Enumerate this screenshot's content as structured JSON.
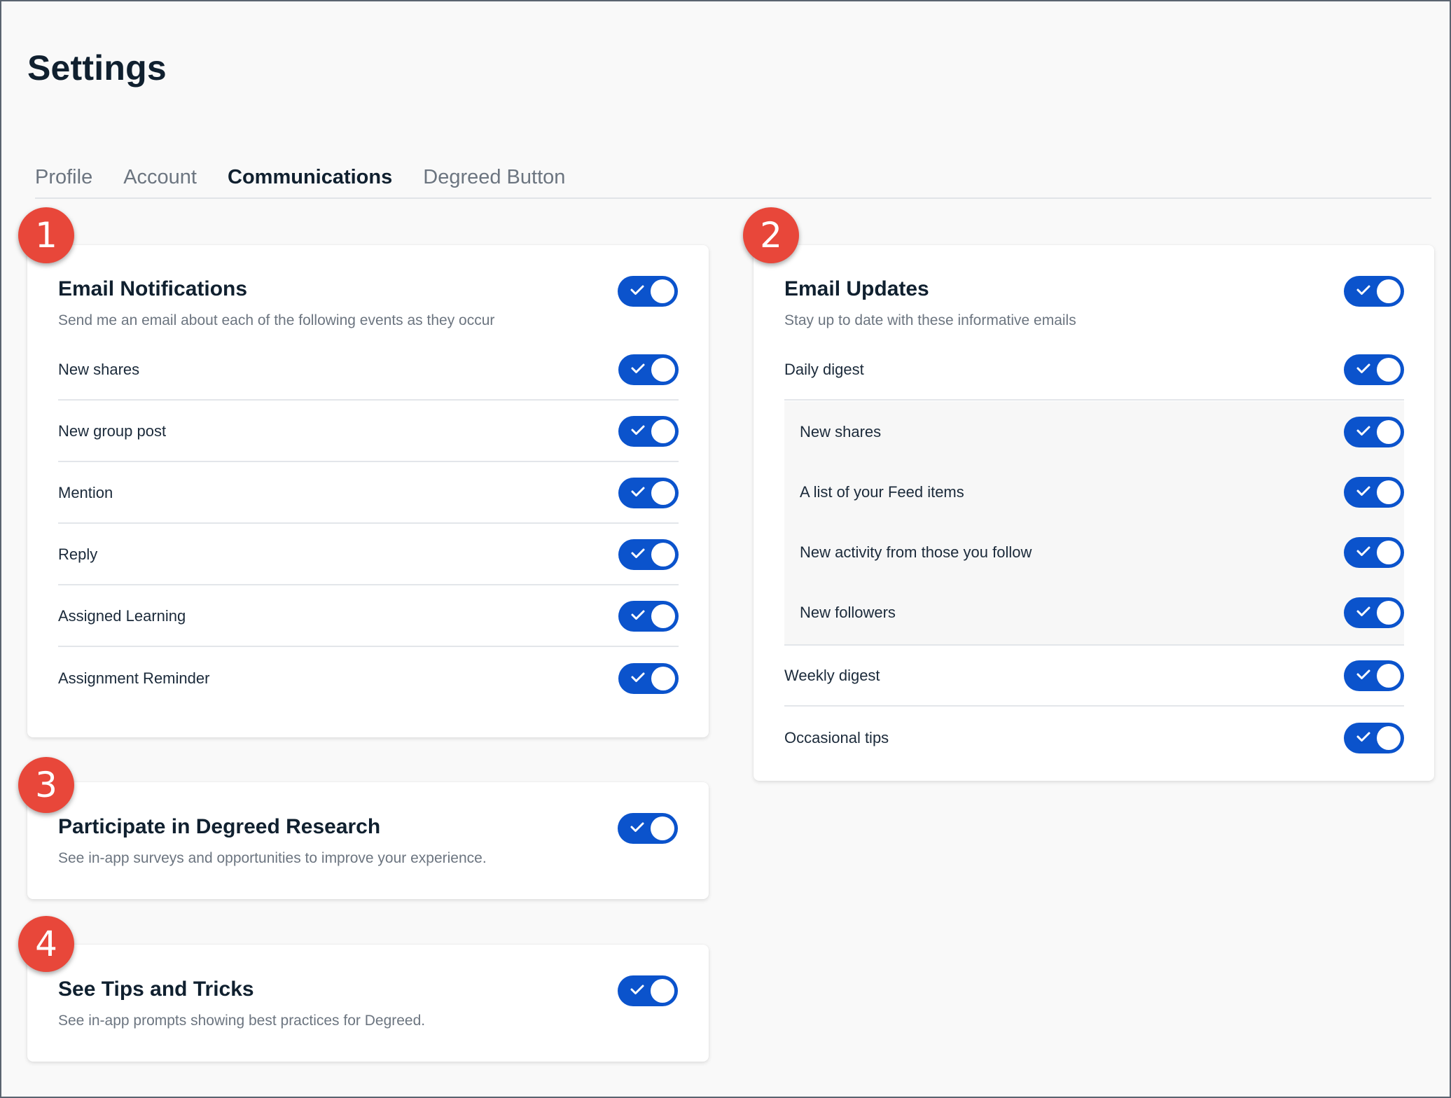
{
  "page": {
    "title": "Settings"
  },
  "tabs": [
    "Profile",
    "Account",
    "Communications",
    "Degreed Button"
  ],
  "active_tab": "Communications",
  "toggle_color": "#0b53cc",
  "badge_color": "#e8473a",
  "email_notifications": {
    "badge": "1",
    "title": "Email Notifications",
    "description": "Send me an email about each of the following events as they occur",
    "master_on": true,
    "items": [
      {
        "label": "New shares",
        "on": true
      },
      {
        "label": "New group post",
        "on": true
      },
      {
        "label": "Mention",
        "on": true
      },
      {
        "label": "Reply",
        "on": true
      },
      {
        "label": "Assigned Learning",
        "on": true
      },
      {
        "label": "Assignment Reminder",
        "on": true
      }
    ]
  },
  "email_updates": {
    "badge": "2",
    "title": "Email Updates",
    "description": "Stay up to date with these informative emails",
    "master_on": true,
    "daily_digest": {
      "label": "Daily digest",
      "on": true
    },
    "daily_sub_items": [
      {
        "label": "New shares",
        "on": true
      },
      {
        "label": "A list of your Feed items",
        "on": true
      },
      {
        "label": "New activity from those you follow",
        "on": true
      },
      {
        "label": "New followers",
        "on": true
      }
    ],
    "other_items": [
      {
        "label": "Weekly digest",
        "on": true
      },
      {
        "label": "Occasional tips",
        "on": true
      }
    ]
  },
  "research": {
    "badge": "3",
    "title": "Participate in Degreed Research",
    "description": "See in-app surveys and opportunities to improve your experience.",
    "on": true
  },
  "tips": {
    "badge": "4",
    "title": "See Tips and Tricks",
    "description": "See in-app prompts showing best practices for Degreed.",
    "on": true
  }
}
